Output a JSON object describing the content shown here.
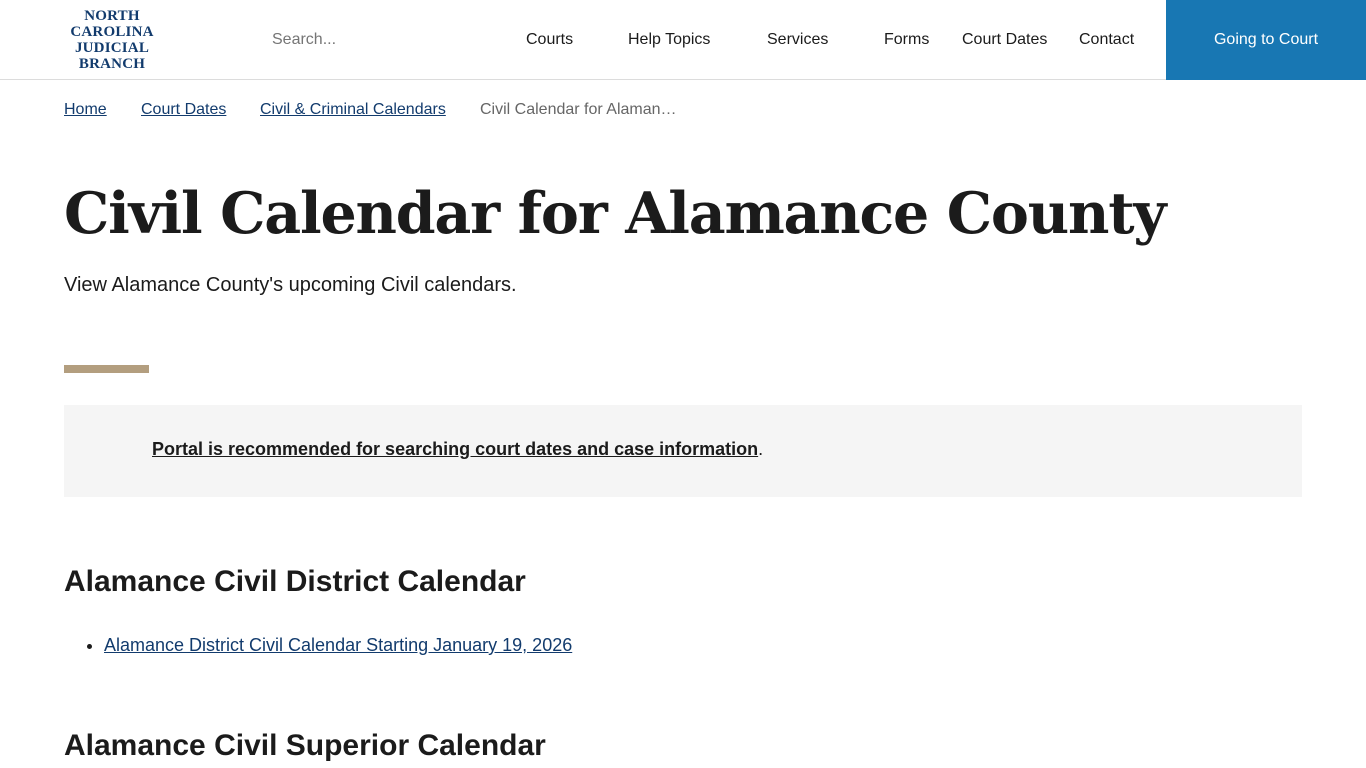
{
  "header": {
    "logo_lines": [
      "NORTH",
      "CAROLINA",
      "JUDICIAL",
      "BRANCH"
    ],
    "search_placeholder": "Search...",
    "nav": [
      "Courts",
      "Help Topics",
      "Services",
      "Forms",
      "Court Dates",
      "Contact"
    ],
    "cta_label": "Going to Court"
  },
  "breadcrumb": {
    "items": [
      "Home",
      "Court Dates",
      "Civil & Criminal Calendars"
    ],
    "current": "Civil Calendar for Alaman…"
  },
  "page": {
    "title": "Civil Calendar for Alamance County",
    "intro": "View Alamance County's upcoming Civil calendars."
  },
  "alert": {
    "link_text": "Portal is recommended for searching court dates and case information",
    "suffix": "."
  },
  "sections": [
    {
      "heading": "Alamance Civil District Calendar",
      "links": [
        "Alamance District Civil Calendar Starting January 19, 2026"
      ]
    },
    {
      "heading": "Alamance Civil Superior Calendar"
    }
  ],
  "colors": {
    "brand_navy": "#123b6d",
    "cta_blue": "#1877b3",
    "accent_tan": "#b39e7f",
    "alert_bg": "#f5f5f5"
  }
}
